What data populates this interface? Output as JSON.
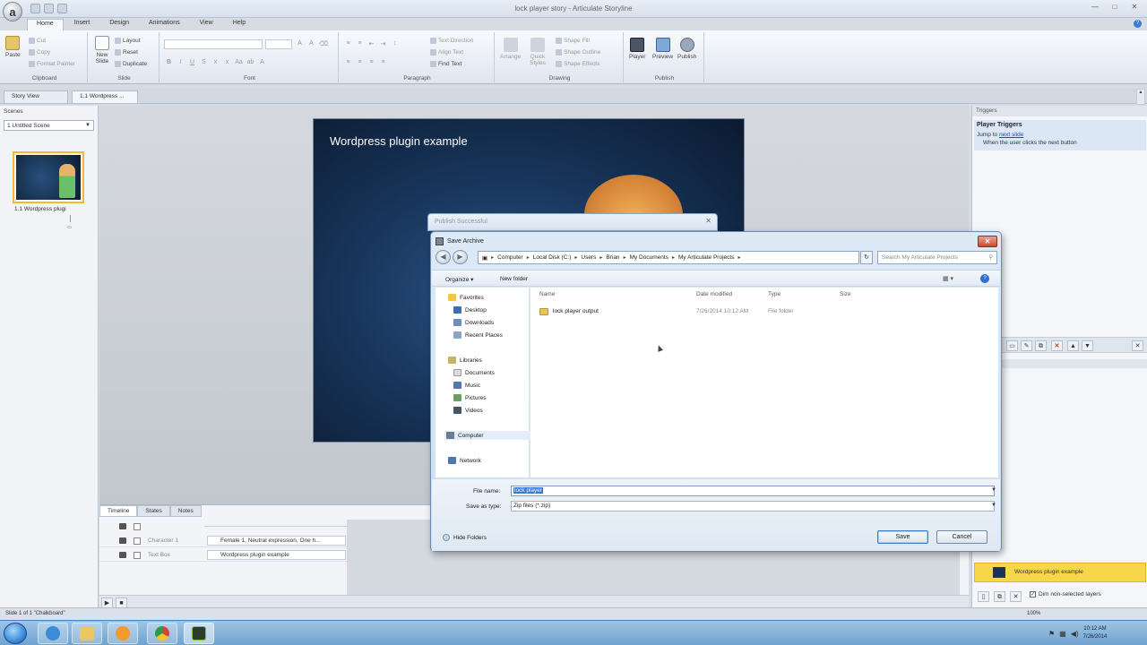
{
  "app": {
    "window_title": "lock player story - Articulate Storyline",
    "orb_letter": "a",
    "window_controls": [
      "—",
      "□",
      "✕"
    ]
  },
  "ribbon": {
    "tabs": [
      "Home",
      "Insert",
      "Design",
      "Animations",
      "View",
      "Help"
    ],
    "active_tab": "Home",
    "groups": {
      "clipboard": {
        "label": "Clipboard",
        "paste": "Paste",
        "cut": "Cut",
        "copy": "Copy",
        "format_painter": "Format Painter"
      },
      "slide": {
        "label": "Slide",
        "new_slide": "New Slide",
        "layout": "Layout",
        "reset": "Reset",
        "duplicate": "Duplicate"
      },
      "font": {
        "label": "Font"
      },
      "paragraph": {
        "label": "Paragraph",
        "text_direction": "Text Direction",
        "align_text": "Align Text",
        "find_text": "Find Text"
      },
      "drawing": {
        "label": "Drawing",
        "arrange": "Arrange",
        "quick_styles": "Quick Styles",
        "shape_fill": "Shape Fill",
        "shape_outline": "Shape Outline",
        "shape_effects": "Shape Effects"
      },
      "publish": {
        "label": "Publish",
        "player": "Player",
        "preview": "Preview",
        "publish": "Publish"
      }
    }
  },
  "doc_tabs": [
    "Story View",
    "1.1 Wordpress ..."
  ],
  "scenes_panel": {
    "header": "Scenes",
    "scene_select": "1 Untitled Scene",
    "slide_caption": "1.1 Wordpress plugi"
  },
  "slide": {
    "title": "Wordpress plugin example"
  },
  "triggers_panel": {
    "header": "Triggers",
    "title": "Player Triggers",
    "jump_prefix": "Jump to ",
    "jump_link": "next slide",
    "when": "When the user clicks the next button",
    "layer_label": "Wordpress plugin example",
    "dim_label": "Dim non-selected layers"
  },
  "timeline": {
    "tabs": [
      "Timeline",
      "States",
      "Notes"
    ],
    "rows": [
      {
        "name": "Character 1",
        "content": "Female 1, Neutral expression, One h..."
      },
      {
        "name": "Text Box",
        "content": "Wordpress plugin example"
      }
    ]
  },
  "status": {
    "left": "Slide 1 of 1     \"Chalkboard\"",
    "zoom": "100%"
  },
  "taskbar": {
    "clock_time": "10:12 AM",
    "clock_date": "7/26/2014"
  },
  "publish_dialog": {
    "title": "Publish Successful"
  },
  "save_dialog": {
    "title": "Save Archive",
    "breadcrumb": [
      "Computer",
      "Local Disk (C:)",
      "Users",
      "Brian",
      "My Documents",
      "My Articulate Projects"
    ],
    "search_placeholder": "Search My Articulate Projects",
    "toolbar": {
      "organize": "Organize ▾",
      "new_folder": "New folder"
    },
    "nav": {
      "favorites": "Favorites",
      "desktop": "Desktop",
      "downloads": "Downloads",
      "recent_places": "Recent Places",
      "libraries": "Libraries",
      "documents": "Documents",
      "music": "Music",
      "pictures": "Pictures",
      "videos": "Videos",
      "computer": "Computer",
      "network": "Network"
    },
    "columns": {
      "name": "Name",
      "date": "Date modified",
      "type": "Type",
      "size": "Size"
    },
    "files": [
      {
        "name": "lock player output",
        "date": "7/26/2014 10:12 AM",
        "type": "File folder"
      }
    ],
    "file_name_label": "File name:",
    "file_name_value": "lock player",
    "save_type_label": "Save as type:",
    "save_type_value": "Zip files (*.zip)",
    "hide_folders": "Hide Folders",
    "save_button": "Save",
    "cancel_button": "Cancel"
  }
}
